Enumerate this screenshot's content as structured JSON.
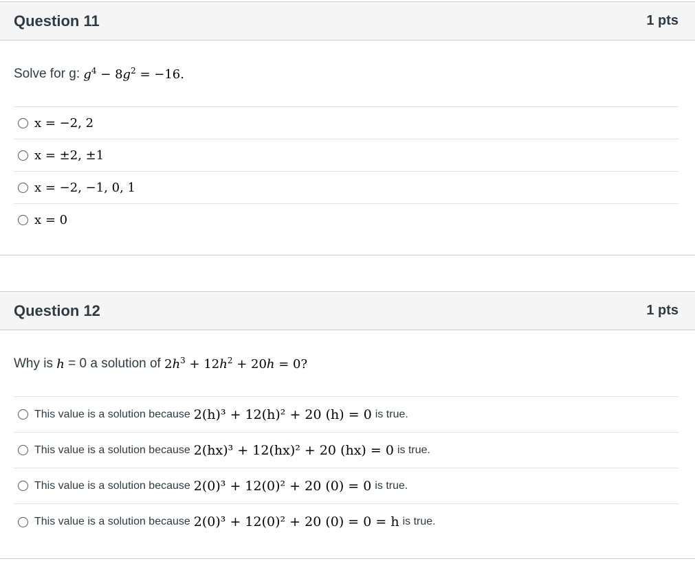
{
  "questions": [
    {
      "title": "Question 11",
      "points": "1 pts",
      "prompt_prefix": "Solve for g:",
      "prompt_math": "g⁴ − 8g² = −16.",
      "answers": [
        "x = −2, 2",
        "x = ±2, ±1",
        "x = −2, −1, 0, 1",
        "x = 0"
      ]
    },
    {
      "title": "Question 12",
      "points": "1 pts",
      "prompt_prefix": "Why is",
      "prompt_var": "h",
      "prompt_mid": "= 0 a solution of",
      "prompt_math": "2h³ + 12h² + 20h = 0",
      "prompt_suffix": "?",
      "answer_prefix": "This value is a solution because",
      "answer_suffix": "is true.",
      "answers": [
        "2(h)³ + 12(h)² + 20 (h) = 0",
        "2(hx)³ + 12(hx)² + 20 (hx) = 0",
        "2(0)³ + 12(0)² + 20 (0) = 0",
        "2(0)³ + 12(0)² + 20 (0) = 0 = h"
      ]
    }
  ],
  "colors": {
    "header_bg": "#f5f5f5",
    "border": "#c7cdd1",
    "text": "#2d3b45"
  }
}
